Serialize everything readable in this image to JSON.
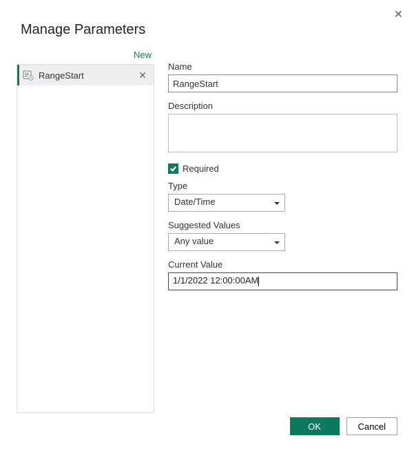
{
  "dialog": {
    "title": "Manage Parameters",
    "new_link": "New",
    "ok_label": "OK",
    "cancel_label": "Cancel"
  },
  "sidebar": {
    "items": [
      {
        "name": "RangeStart"
      }
    ]
  },
  "form": {
    "name_label": "Name",
    "name_value": "RangeStart",
    "description_label": "Description",
    "description_value": "",
    "required_label": "Required",
    "required_checked": true,
    "type_label": "Type",
    "type_value": "Date/Time",
    "suggested_label": "Suggested Values",
    "suggested_value": "Any value",
    "current_label": "Current Value",
    "current_value": "1/1/2022 12:00:00AM"
  }
}
